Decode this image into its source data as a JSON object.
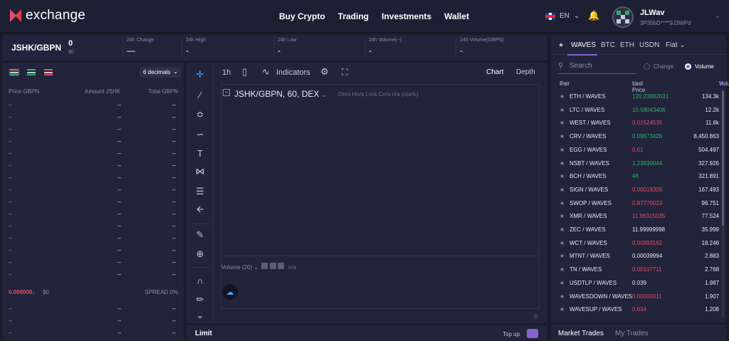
{
  "brand": {
    "name": "exchange"
  },
  "nav": {
    "items": [
      "Buy Crypto",
      "Trading",
      "Investments",
      "Wallet"
    ]
  },
  "header": {
    "language": "EN",
    "user_name": "JLWav",
    "user_address": "3P35bD****9J3WPd"
  },
  "ticker": {
    "pair": "JSHK/GBPN",
    "price": "0",
    "price_usd": "$0",
    "stats": [
      {
        "label": "24h Change",
        "value": "—"
      },
      {
        "label": "24h High",
        "value": "-"
      },
      {
        "label": "24h Low",
        "value": "-"
      },
      {
        "label": "24h Volume(--)",
        "value": "-"
      },
      {
        "label": "24h Volume(GBPN)",
        "value": "-"
      }
    ]
  },
  "orderbook": {
    "decimals_label": "6 decimals",
    "headers": {
      "price": "Price GBPN",
      "amount": "Amount JSHK",
      "total": "Total GBPN"
    },
    "ask_rows": 15,
    "bid_rows": 3,
    "placeholder_price": "–",
    "placeholder_value": "–",
    "mid_price": "0.000000↓",
    "mid_usd": "$0",
    "spread": "SPREAD 0%"
  },
  "chart": {
    "interval": "1h",
    "indicators_label": "Indicators",
    "view_chart": "Chart",
    "view_depth": "Depth",
    "title": "JSHK/GBPN, 60, DEX",
    "ohlc": "On/a Hn/a Ln/a Cn/a n/a (n/a%)",
    "volume_label": "Volume (20)",
    "volume_value": "n/a"
  },
  "order_form": {
    "title": "Limit",
    "top_up": "Top up"
  },
  "markets": {
    "tabs": [
      "WAVES",
      "BTC",
      "ETH",
      "USDN",
      "Fiat"
    ],
    "active_tab": "WAVES",
    "search_placeholder": "Search",
    "sort_change": "Change",
    "sort_volume": "Volume",
    "headers": {
      "pair": "Pair",
      "last_price": "Last Price",
      "volume": "Volume"
    },
    "rows": [
      {
        "pair": "ETH / WAVES",
        "last_price": "120.23882031",
        "volume": "134.3k",
        "trend": "up"
      },
      {
        "pair": "LTC / WAVES",
        "last_price": "10.58043406",
        "volume": "12.2k",
        "trend": "up"
      },
      {
        "pair": "WEST / WAVES",
        "last_price": "0.01524535",
        "volume": "11.6k",
        "trend": "down"
      },
      {
        "pair": "CRV / WAVES",
        "last_price": "0.09673426",
        "volume": "8,450.863",
        "trend": "up"
      },
      {
        "pair": "EGG / WAVES",
        "last_price": "0.61",
        "volume": "504.497",
        "trend": "down"
      },
      {
        "pair": "NSBT / WAVES",
        "last_price": "1.23630044",
        "volume": "327.926",
        "trend": "up"
      },
      {
        "pair": "BCH / WAVES",
        "last_price": "48",
        "volume": "321.891",
        "trend": "up"
      },
      {
        "pair": "SIGN / WAVES",
        "last_price": "0.00019309",
        "volume": "167.493",
        "trend": "down"
      },
      {
        "pair": "SWOP / WAVES",
        "last_price": "0.87770023",
        "volume": "96.751",
        "trend": "down"
      },
      {
        "pair": "XMR / WAVES",
        "last_price": "11.96315035",
        "volume": "77.524",
        "trend": "down"
      },
      {
        "pair": "ZEC / WAVES",
        "last_price": "11.99999998",
        "volume": "35.999",
        "trend": "neutral"
      },
      {
        "pair": "WCT / WAVES",
        "last_price": "0.00893162",
        "volume": "18.246",
        "trend": "down"
      },
      {
        "pair": "MTNT / WAVES",
        "last_price": "0.00039994",
        "volume": "2.883",
        "trend": "neutral"
      },
      {
        "pair": "TN / WAVES",
        "last_price": "0.00107711",
        "volume": "2.768",
        "trend": "down"
      },
      {
        "pair": "USDTLP / WAVES",
        "last_price": "0.039",
        "volume": "1.987",
        "trend": "neutral"
      },
      {
        "pair": "WAVESDOWN / WAVES",
        "last_price": "0.00000011",
        "volume": "1.907",
        "trend": "down"
      },
      {
        "pair": "WAVESUP / WAVES",
        "last_price": "0.634",
        "volume": "1.208",
        "trend": "down"
      }
    ]
  },
  "trades": {
    "tab_market": "Market Trades",
    "tab_mine": "My Trades"
  },
  "colors": {
    "up": "#2fb26b",
    "down": "#e34d67",
    "accent": "#8a63d2",
    "background": "#1a1c2b",
    "panel": "#21243a"
  }
}
